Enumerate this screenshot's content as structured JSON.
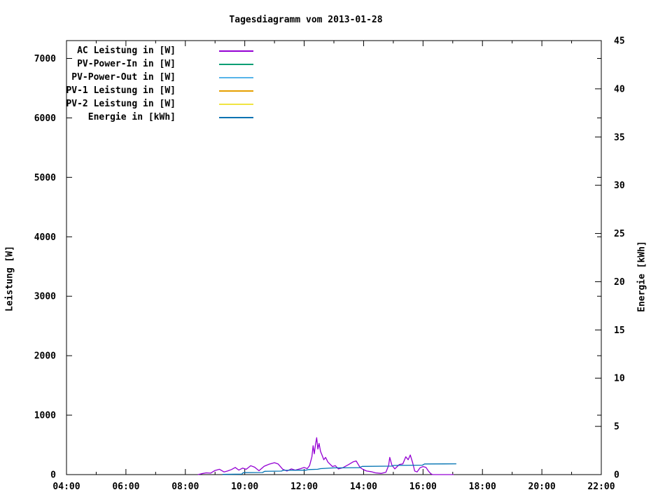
{
  "page": {
    "background": "#ffffff",
    "foreground": "#000000"
  },
  "chart_data": {
    "type": "line",
    "title": "Tagesdiagramm vom 2013-01-28",
    "xlabel": "",
    "ylabel": "Leistung [W]",
    "y2label": "Energie [kWh]",
    "grid": false,
    "legend_position": "top-left-inside",
    "x_axis": {
      "unit": "time-of-day",
      "start_hour": 4,
      "end_hour": 22,
      "major_tick_every_hours": 2,
      "minor_tick_every_hours": 1,
      "tick_labels": [
        "04:00",
        "06:00",
        "08:00",
        "10:00",
        "12:00",
        "14:00",
        "16:00",
        "18:00",
        "20:00",
        "22:00"
      ]
    },
    "y1_axis": {
      "label": "Leistung [W]",
      "min": 0,
      "max_labeled": 7000,
      "plot_max": 7300,
      "tick_step": 1000,
      "tick_labels": [
        "0",
        "1000",
        "2000",
        "3000",
        "4000",
        "5000",
        "6000",
        "7000"
      ]
    },
    "y2_axis": {
      "label": "Energie [kWh]",
      "min": 0,
      "max": 45,
      "tick_step": 5,
      "tick_labels": [
        "0",
        "5",
        "10",
        "15",
        "20",
        "25",
        "30",
        "35",
        "40",
        "45"
      ]
    },
    "series": [
      {
        "name": "AC Leistung in [W]",
        "color": "#9400d3",
        "axis": "y1",
        "points": [
          [
            8.42,
            0
          ],
          [
            8.55,
            15
          ],
          [
            8.7,
            30
          ],
          [
            8.85,
            25
          ],
          [
            9.0,
            70
          ],
          [
            9.15,
            90
          ],
          [
            9.3,
            45
          ],
          [
            9.42,
            60
          ],
          [
            9.55,
            85
          ],
          [
            9.68,
            120
          ],
          [
            9.8,
            75
          ],
          [
            9.93,
            110
          ],
          [
            10.05,
            90
          ],
          [
            10.2,
            150
          ],
          [
            10.33,
            125
          ],
          [
            10.48,
            65
          ],
          [
            10.65,
            140
          ],
          [
            10.82,
            175
          ],
          [
            11.0,
            200
          ],
          [
            11.12,
            180
          ],
          [
            11.28,
            90
          ],
          [
            11.42,
            60
          ],
          [
            11.57,
            95
          ],
          [
            11.7,
            75
          ],
          [
            11.88,
            100
          ],
          [
            12.0,
            120
          ],
          [
            12.1,
            100
          ],
          [
            12.18,
            150
          ],
          [
            12.26,
            300
          ],
          [
            12.3,
            485
          ],
          [
            12.34,
            350
          ],
          [
            12.38,
            505
          ],
          [
            12.42,
            620
          ],
          [
            12.46,
            430
          ],
          [
            12.5,
            525
          ],
          [
            12.55,
            390
          ],
          [
            12.6,
            330
          ],
          [
            12.66,
            250
          ],
          [
            12.72,
            290
          ],
          [
            12.8,
            210
          ],
          [
            12.95,
            135
          ],
          [
            13.05,
            150
          ],
          [
            13.15,
            95
          ],
          [
            13.3,
            115
          ],
          [
            13.5,
            170
          ],
          [
            13.65,
            215
          ],
          [
            13.75,
            230
          ],
          [
            13.88,
            120
          ],
          [
            13.97,
            90
          ],
          [
            14.1,
            60
          ],
          [
            14.25,
            50
          ],
          [
            14.4,
            30
          ],
          [
            14.6,
            20
          ],
          [
            14.75,
            40
          ],
          [
            14.84,
            150
          ],
          [
            14.88,
            290
          ],
          [
            14.95,
            160
          ],
          [
            15.05,
            95
          ],
          [
            15.2,
            170
          ],
          [
            15.32,
            180
          ],
          [
            15.42,
            300
          ],
          [
            15.5,
            250
          ],
          [
            15.57,
            330
          ],
          [
            15.65,
            200
          ],
          [
            15.72,
            60
          ],
          [
            15.8,
            45
          ],
          [
            15.9,
            115
          ],
          [
            16.0,
            135
          ],
          [
            16.1,
            120
          ],
          [
            16.18,
            60
          ],
          [
            16.26,
            15
          ],
          [
            16.32,
            0
          ],
          [
            17.03,
            0
          ]
        ]
      },
      {
        "name": "PV-Power-In in [W]",
        "color": "#009e73",
        "axis": "y1",
        "points": []
      },
      {
        "name": "PV-Power-Out in [W]",
        "color": "#56b4e9",
        "axis": "y1",
        "points": []
      },
      {
        "name": "PV-1 Leistung in [W]",
        "color": "#e69f00",
        "axis": "y1",
        "points": []
      },
      {
        "name": "PV-2 Leistung in [W]",
        "color": "#f0e442",
        "axis": "y1",
        "points": []
      },
      {
        "name": "Energie in [kWh]",
        "color": "#0072b2",
        "axis": "y2",
        "points": [
          [
            9.25,
            0.02
          ],
          [
            9.9,
            0.05
          ],
          [
            9.95,
            0.2
          ],
          [
            10.6,
            0.22
          ],
          [
            10.67,
            0.34
          ],
          [
            11.23,
            0.36
          ],
          [
            11.3,
            0.44
          ],
          [
            12.05,
            0.46
          ],
          [
            12.15,
            0.52
          ],
          [
            12.45,
            0.55
          ],
          [
            12.55,
            0.62
          ],
          [
            12.9,
            0.68
          ],
          [
            13.0,
            0.7
          ],
          [
            13.85,
            0.72
          ],
          [
            13.95,
            0.85
          ],
          [
            14.95,
            0.88
          ],
          [
            15.02,
            0.95
          ],
          [
            15.98,
            0.98
          ],
          [
            16.05,
            1.1
          ],
          [
            17.12,
            1.12
          ]
        ]
      }
    ]
  }
}
